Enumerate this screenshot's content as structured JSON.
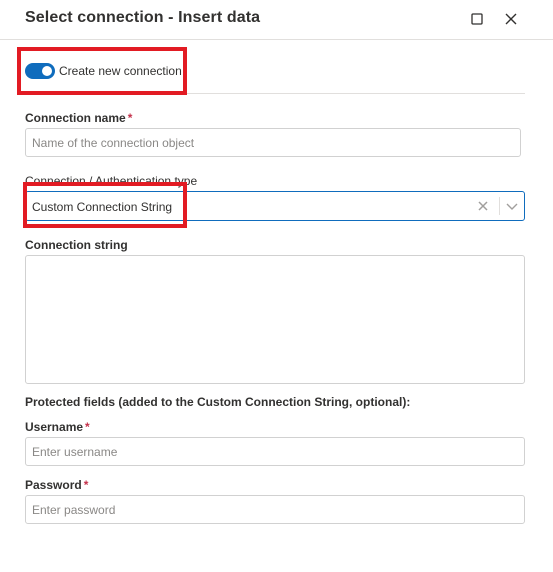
{
  "dialog": {
    "title": "Select connection - Insert data"
  },
  "toggle": {
    "label": "Create new connection",
    "on": true
  },
  "fields": {
    "connection_name": {
      "label": "Connection name",
      "required_mark": "*",
      "placeholder": "Name of the connection object",
      "value": ""
    },
    "auth_type": {
      "label": "Connection / Authentication type",
      "value": "Custom Connection String"
    },
    "connection_string": {
      "label": "Connection string",
      "value": ""
    },
    "protected_heading": "Protected fields (added to the Custom Connection String, optional):",
    "username": {
      "label": "Username",
      "required_mark": "*",
      "placeholder": "Enter username",
      "value": ""
    },
    "password": {
      "label": "Password",
      "required_mark": "*",
      "placeholder": "Enter password",
      "value": ""
    }
  },
  "icons": {
    "maximize": "maximize-icon",
    "close": "close-icon",
    "clear": "clear-icon",
    "dropdown": "chevron-down-icon"
  },
  "colors": {
    "accent": "#0f6cbd",
    "required": "#c4314b",
    "highlight": "#e21b23"
  }
}
